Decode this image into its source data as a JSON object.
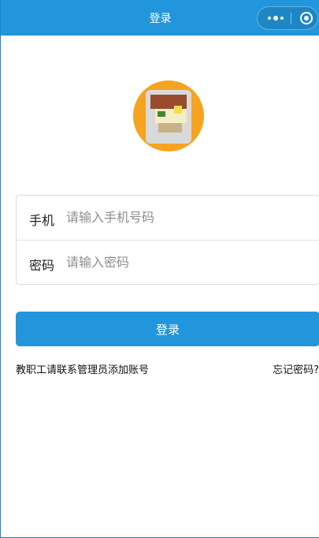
{
  "navbar": {
    "title": "登录",
    "capsule": {
      "more_icon": "more-dots-icon",
      "close_icon": "record-circle-icon"
    }
  },
  "avatar": {
    "icon": "food-photo-avatar"
  },
  "form": {
    "phone": {
      "label": "手机",
      "placeholder": "请输入手机号码",
      "value": ""
    },
    "password": {
      "label": "密码",
      "placeholder": "请输入密码",
      "value": ""
    }
  },
  "login_button": {
    "label": "登录"
  },
  "links": {
    "staff_note": "教职工请联系管理员添加账号",
    "forgot_password": "忘记密码?"
  },
  "colors": {
    "primary": "#2196dc",
    "avatar_ring": "#f6a320",
    "placeholder": "#8e8e8e"
  }
}
